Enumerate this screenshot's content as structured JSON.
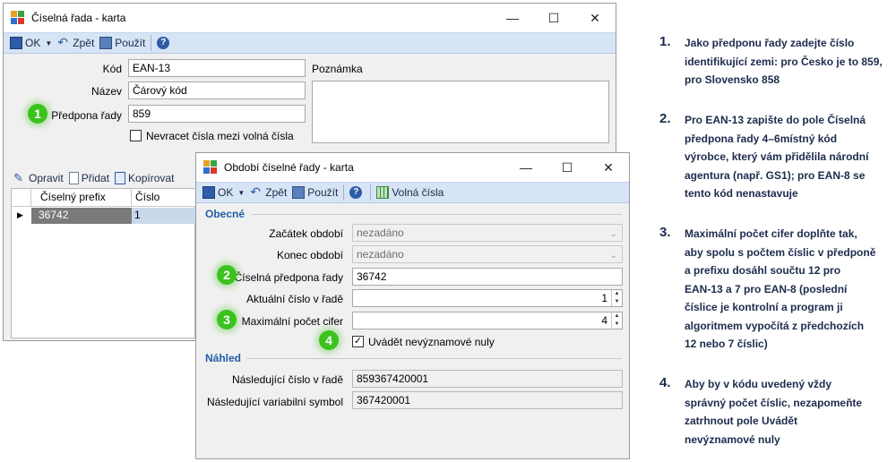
{
  "win1": {
    "title": "Číselná řada - karta",
    "toolbar": {
      "ok": "OK",
      "back": "Zpět",
      "use": "Použít"
    },
    "fields": {
      "kod_label": "Kód",
      "kod_value": "EAN-13",
      "nazev_label": "Název",
      "nazev_value": "Čárový kód",
      "prefix_label": "Předpona řady",
      "prefix_value": "859",
      "poznamka_label": "Poznámka",
      "recycle_label": "Nevracet čísla mezi volná čísla"
    },
    "grid_toolbar": {
      "edit": "Opravit",
      "add": "Přidat",
      "copy": "Kopírovat"
    },
    "grid": {
      "columns": [
        "Číselný prefix",
        "Číslo"
      ],
      "rows": [
        [
          "36742",
          "1"
        ]
      ]
    }
  },
  "win2": {
    "title": "Období číselné řady - karta",
    "toolbar": {
      "ok": "OK",
      "back": "Zpět",
      "use": "Použít",
      "free": "Volná čísla"
    },
    "section_general": "Obecné",
    "section_preview": "Náhled",
    "fields": {
      "start_label": "Začátek období",
      "start_value": "nezadáno",
      "end_label": "Konec období",
      "end_value": "nezadáno",
      "prefix_label": "Číselná předpona řady",
      "prefix_value": "36742",
      "current_label": "Aktuální číslo v řadě",
      "current_value": "1",
      "max_label": "Maximální počet cifer",
      "max_value": "4",
      "zeros_label": "Uvádět nevýznamové nuly",
      "next_label": "Následující číslo v řadě",
      "next_value": "859367420001",
      "varsym_label": "Následující variabilní symbol",
      "varsym_value": "367420001"
    }
  },
  "badges": [
    "1",
    "2",
    "3",
    "4"
  ],
  "steps": [
    {
      "num": "1.",
      "lines": [
        "Jako předponu řady zadejte číslo",
        "identifikující zemi: pro Česko je to 859,",
        "pro Slovensko 858"
      ]
    },
    {
      "num": "2.",
      "lines": [
        "Pro EAN-13 zapište do pole Číselná",
        "předpona řady 4–6místný kód",
        "výrobce, který vám přidělila národní",
        "agentura (např. GS1); pro EAN-8 se",
        "tento kód nenastavuje"
      ]
    },
    {
      "num": "3.",
      "lines": [
        "Maximální počet cifer doplňte tak,",
        "aby spolu s počtem číslic v předponě",
        "a prefixu dosáhl součtu 12 pro",
        "EAN-13 a 7 pro EAN-8 (poslední",
        "číslice je kontrolní a program ji",
        "algoritmem vypočítá z předchozích",
        "12 nebo 7 číslic)"
      ]
    },
    {
      "num": "4.",
      "lines": [
        "Aby by v kódu uvedený vždy",
        "správný počet číslic, nezapomeňte",
        "zatrhnout pole Uvádět",
        "nevýznamové nuly"
      ]
    }
  ],
  "colors": {
    "accent_blue": "#1f5fa8",
    "badge_green": "#3cc21e",
    "toolbar_bg": "#d6e4f5"
  }
}
